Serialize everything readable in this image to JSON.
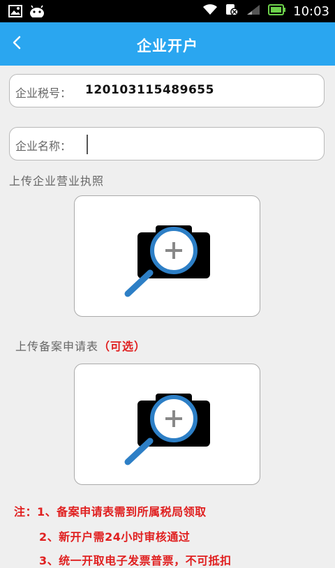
{
  "status_bar": {
    "time": "10:03",
    "icons": [
      "image-icon",
      "android-icon",
      "wifi-icon",
      "sim-off-icon",
      "signal-icon",
      "battery-icon"
    ]
  },
  "app_bar": {
    "title": "企业开户",
    "back_icon": "chevron-left-icon",
    "color": "#2aa6f0"
  },
  "form": {
    "tax_id_label": "企业税号：",
    "tax_id_value": "120103115489655",
    "company_name_label": "企业名称：",
    "company_name_value": ""
  },
  "uploads": {
    "license_label": "上传企业营业执照",
    "filing_label": "上传备案申请表",
    "filing_optional": "（可选）",
    "upload_icon": "camera-search-add-icon"
  },
  "notes": {
    "line1": "注：1、备案申请表需到所属税局领取",
    "line2": "2、新开户需24小时审核通过",
    "line3": "3、统一开取电子发票普票，不可抵扣"
  },
  "colors": {
    "accent": "#2aa6f0",
    "note_red": "#e02020"
  }
}
